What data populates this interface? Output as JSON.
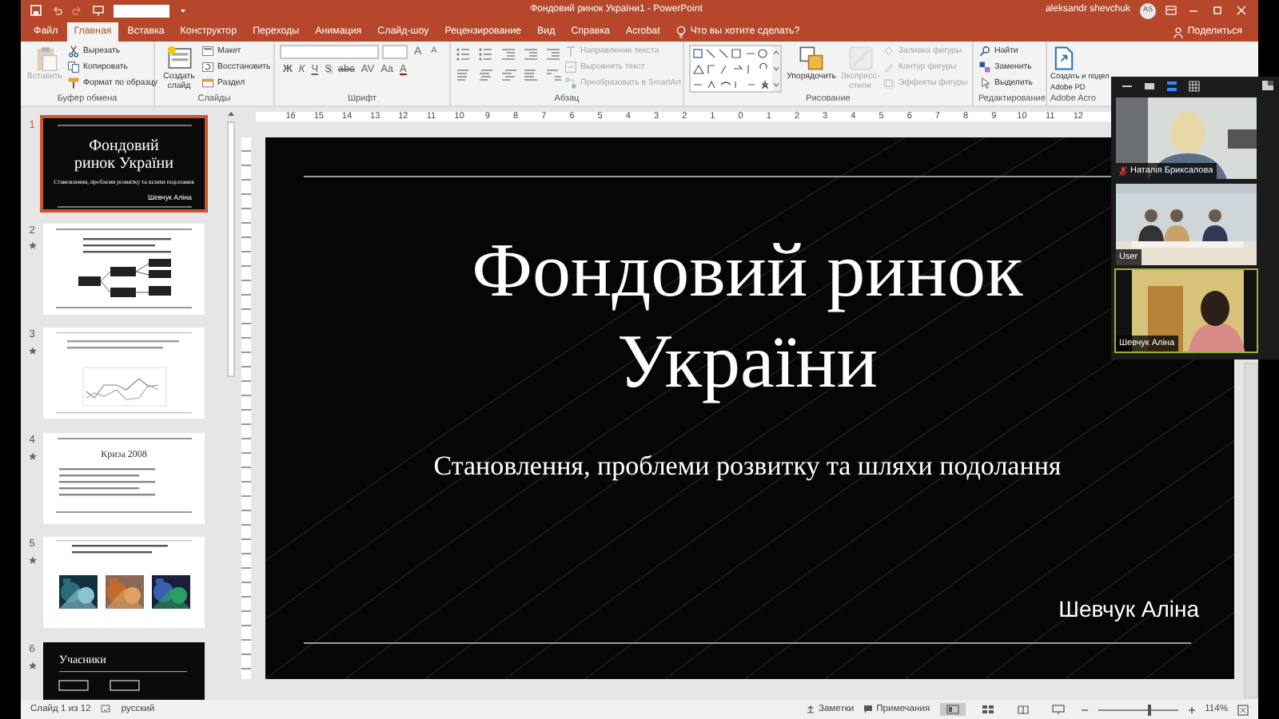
{
  "window": {
    "title": "Фондовий ринок України1 - PowerPoint",
    "user": "aleksandr shevchuk",
    "avatar": "AS"
  },
  "ribbon_tabs": [
    {
      "label": "Файл",
      "selected": false
    },
    {
      "label": "Главная",
      "selected": true
    },
    {
      "label": "Вставка",
      "selected": false
    },
    {
      "label": "Конструктор",
      "selected": false
    },
    {
      "label": "Переходы",
      "selected": false
    },
    {
      "label": "Анимация",
      "selected": false
    },
    {
      "label": "Слайд-шоу",
      "selected": false
    },
    {
      "label": "Рецензирование",
      "selected": false
    },
    {
      "label": "Вид",
      "selected": false
    },
    {
      "label": "Справка",
      "selected": false
    },
    {
      "label": "Acrobat",
      "selected": false
    }
  ],
  "tell_me": "Что вы хотите сделать?",
  "share": "Поделиться",
  "ribbon_groups": [
    {
      "label": "Буфер обмена",
      "kind": "clipboard",
      "buttons": [
        {
          "label": "Вставить",
          "kind": "large",
          "disabled": true
        },
        {
          "label": "Вырезать",
          "kind": "small",
          "disabled": false
        },
        {
          "label": "Копировать",
          "kind": "small",
          "disabled": false
        },
        {
          "label": "Формат по образцу",
          "kind": "small",
          "disabled": false
        }
      ]
    },
    {
      "label": "Слайды",
      "kind": "slides",
      "buttons": [
        {
          "label": "Создать слайд",
          "kind": "large",
          "disabled": false
        },
        {
          "label": "Макет",
          "kind": "small",
          "disabled": false
        },
        {
          "label": "Восстановить",
          "kind": "small",
          "disabled": false
        },
        {
          "label": "Раздел",
          "kind": "small",
          "disabled": false
        }
      ]
    },
    {
      "label": "Шрифт",
      "kind": "font",
      "top_glyphs": [
        "A",
        "A"
      ],
      "glyphs": [
        "Ж",
        "К",
        "Ч",
        "S",
        "abc",
        "AV",
        "Aa",
        "A"
      ]
    },
    {
      "label": "Абзац",
      "kind": "paragraph",
      "buttons": [
        {
          "label": "Направление текста",
          "kind": "small",
          "disabled": true
        },
        {
          "label": "Выровнять текст",
          "kind": "small",
          "disabled": true
        },
        {
          "label": "Преобразовать в SmartArt",
          "kind": "small",
          "disabled": true
        }
      ]
    },
    {
      "label": "Рисование",
      "kind": "drawing",
      "buttons": [
        {
          "label": "Упорядочить",
          "kind": "large",
          "disabled": false
        },
        {
          "label": "Экспресс-стили",
          "kind": "large",
          "disabled": true
        },
        {
          "label": "Заливка фигуры",
          "kind": "small",
          "disabled": true
        },
        {
          "label": "Контур фигуры",
          "kind": "small",
          "disabled": true
        },
        {
          "label": "Эффекты фигуры",
          "kind": "small",
          "disabled": true
        }
      ]
    },
    {
      "label": "Редактирование",
      "kind": "editing",
      "buttons": [
        {
          "label": "Найти",
          "kind": "small",
          "disabled": false
        },
        {
          "label": "Заменить",
          "kind": "small",
          "disabled": false
        },
        {
          "label": "Выделить",
          "kind": "small",
          "disabled": false
        }
      ]
    },
    {
      "label": "Adobe Acro",
      "kind": "acrobat",
      "buttons": [
        {
          "label": "Создать и подел",
          "label_line2": "Adobe PD",
          "kind": "large",
          "disabled": false
        }
      ]
    }
  ],
  "ruler": [
    "16",
    "15",
    "14",
    "13",
    "12",
    "11",
    "10",
    "9",
    "8",
    "7",
    "6",
    "5",
    "4",
    "3",
    "2",
    "1",
    "0",
    "1",
    "2",
    "3",
    "4",
    "5",
    "6",
    "7",
    "8",
    "9",
    "10",
    "11",
    "12"
  ],
  "slides": [
    {
      "number": "1",
      "selected": true,
      "transition": false,
      "kind": "title",
      "title": "Фондовий ринок України",
      "subtitle": "Становлення, проблеми розвитку та шляхи подолання",
      "author": "Шевчук Аліна"
    },
    {
      "number": "2",
      "selected": false,
      "transition": true,
      "kind": "diagram"
    },
    {
      "number": "3",
      "selected": false,
      "transition": true,
      "kind": "chart"
    },
    {
      "number": "4",
      "selected": false,
      "transition": true,
      "kind": "bullets",
      "title": "Криза 2008"
    },
    {
      "number": "5",
      "selected": false,
      "transition": true,
      "kind": "photos"
    },
    {
      "number": "6",
      "selected": false,
      "transition": true,
      "kind": "boxes",
      "title": "Учасники"
    }
  ],
  "current_slide": {
    "title": "Фондовий ринок України",
    "subtitle": "Становлення, проблеми розвитку та шляхи подолання",
    "author": "Шевчук Аліна"
  },
  "video_call": {
    "layouts": [
      {
        "selected": false
      },
      {
        "selected": false
      },
      {
        "selected": true
      },
      {
        "selected": false
      }
    ],
    "tiles": [
      {
        "name": "Наталія Бриксалова",
        "muted": true,
        "speaking": false
      },
      {
        "name": "User",
        "muted": false,
        "speaking": false
      },
      {
        "name": "Шевчук Аліна",
        "muted": false,
        "speaking": true
      }
    ]
  },
  "status_bar": {
    "slide_info": "Слайд 1 из 12",
    "language": "русский",
    "notes": "Заметки",
    "comments": "Примечания",
    "views": [
      {
        "selected": true
      },
      {
        "selected": false
      },
      {
        "selected": false
      },
      {
        "selected": false
      }
    ],
    "zoom_slider": {
      "level": 0.62
    },
    "zoom": "114%"
  }
}
